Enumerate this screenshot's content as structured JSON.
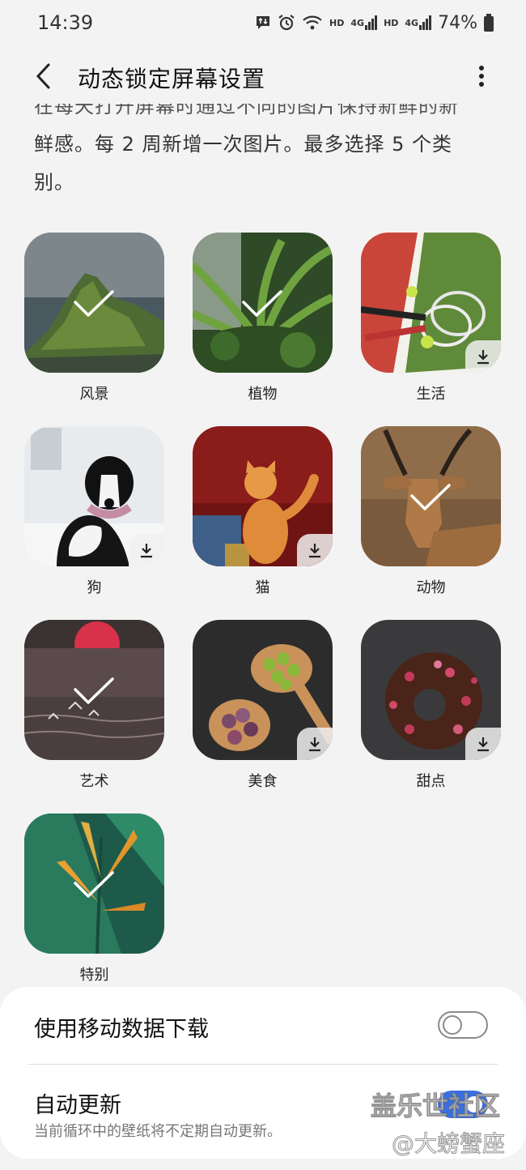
{
  "status_bar": {
    "time": "14:39",
    "hd1": "HD",
    "net1": "4G",
    "hd2": "HD",
    "net2": "4G",
    "battery": "74%"
  },
  "app_bar": {
    "title": "动态锁定屏幕设置",
    "back_icon": "chevron-left-icon",
    "more_icon": "more-vert-icon"
  },
  "description": {
    "partial_line": "在每天打开屏幕时通过不同的图片保持新鲜的新",
    "line2": "鲜感。每 2 周新增一次图片。最多选择 5 个类",
    "line3": "别。"
  },
  "categories": [
    {
      "label": "风景",
      "selected": true,
      "download": false
    },
    {
      "label": "植物",
      "selected": true,
      "download": false
    },
    {
      "label": "生活",
      "selected": false,
      "download": true
    },
    {
      "label": "狗",
      "selected": false,
      "download": true
    },
    {
      "label": "猫",
      "selected": false,
      "download": true
    },
    {
      "label": "动物",
      "selected": true,
      "download": false
    },
    {
      "label": "艺术",
      "selected": true,
      "download": false
    },
    {
      "label": "美食",
      "selected": false,
      "download": true
    },
    {
      "label": "甜点",
      "selected": false,
      "download": true
    },
    {
      "label": "特别",
      "selected": true,
      "download": false
    }
  ],
  "settings": {
    "mobile_data_label": "使用移动数据下载",
    "mobile_data_on": false,
    "auto_update_label": "自动更新",
    "auto_update_desc": "当前循环中的壁纸将不定期自动更新。",
    "auto_update_on": true
  },
  "watermark": {
    "line1": "盖乐世社区",
    "line2": "@大螃蟹座"
  },
  "colors": {
    "accent": "#3a6fe0",
    "background": "#f3f3f3"
  }
}
